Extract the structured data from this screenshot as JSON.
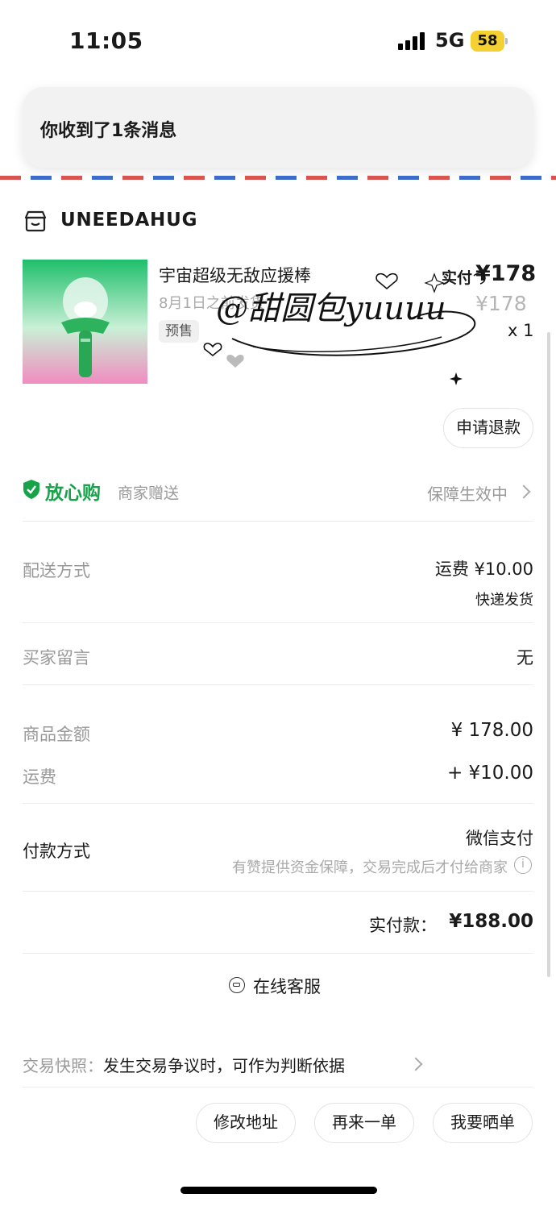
{
  "status_bar": {
    "time": "11:05",
    "network": "5G",
    "battery": "58"
  },
  "notification": {
    "text": "你收到了1条消息"
  },
  "shop": {
    "name": "UNEEDAHUG",
    "icon": "store-icon"
  },
  "product": {
    "title": "宇宙超级无敌应援棒",
    "ship_note": "8月1日之前发货",
    "tag": "预售",
    "paid_label": "实付",
    "paid_price": "¥178",
    "original_price": "¥178",
    "quantity": "x 1",
    "watermark": "@甜圆包yuuuu"
  },
  "refund_button": "申请退款",
  "assurance": {
    "title": "放心购",
    "subtitle": "商家赠送",
    "status": "保障生效中"
  },
  "delivery": {
    "label": "配送方式",
    "fee": "运费 ¥10.00",
    "method": "快递发货"
  },
  "buyer_note": {
    "label": "买家留言",
    "value": "无"
  },
  "amounts": {
    "goods_label": "商品金额",
    "goods_value": "¥ 178.00",
    "shipping_label": "运费",
    "shipping_value": "+ ¥10.00"
  },
  "payment": {
    "label": "付款方式",
    "method": "微信支付",
    "note": "有赞提供资金保障，交易完成后才付给商家"
  },
  "total": {
    "label": "实付款：",
    "value": "¥188.00"
  },
  "customer_service": "在线客服",
  "snapshot": {
    "label": "交易快照：",
    "text": "发生交易争议时，可作为判断依据"
  },
  "actions": {
    "modify_address": "修改地址",
    "reorder": "再来一单",
    "share": "我要晒单"
  },
  "colors": {
    "assurance_green": "#17a34a",
    "battery_yellow": "#f5d033",
    "airmail_red": "#d9534f",
    "airmail_blue": "#3b6cc9"
  }
}
